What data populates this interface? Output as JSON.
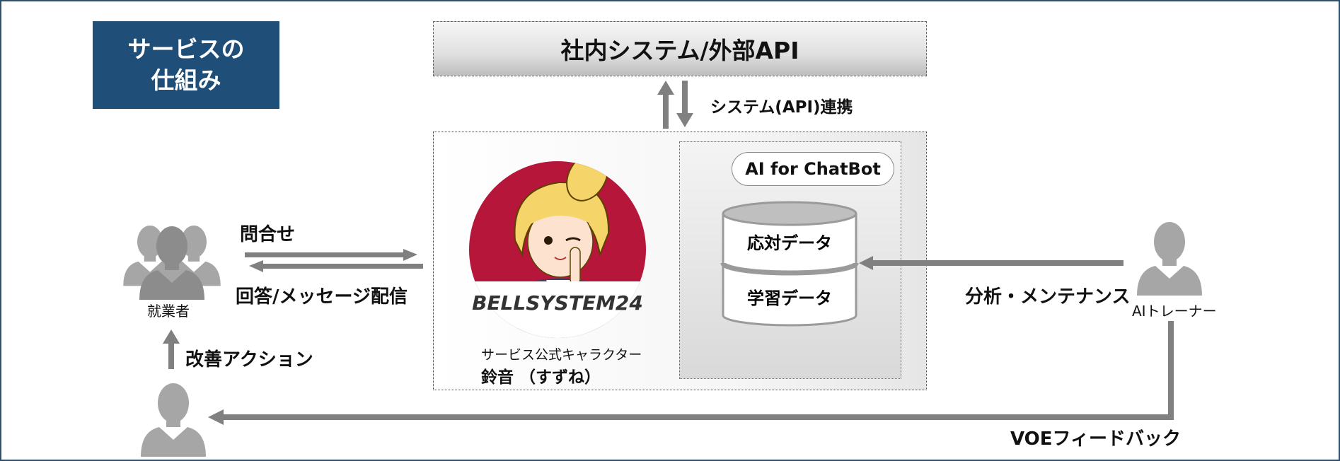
{
  "badge": {
    "line1": "サービスの",
    "line2": "仕組み"
  },
  "system": {
    "title": "社内システム/外部API",
    "link_label": "システム(API)連携"
  },
  "ai": {
    "title": "AI for ChatBot",
    "db_top": "応対データ",
    "db_bottom": "学習データ"
  },
  "character": {
    "brand": "BELLSYSTEM24",
    "caption": "サービス公式キャラクター",
    "name": "鈴音 （すずね）"
  },
  "users": {
    "label": "就業者"
  },
  "trainer": {
    "label": "AIトレーナー"
  },
  "flows": {
    "inquiry": "問合せ",
    "reply": "回答/メッセージ配信",
    "improve": "改善アクション",
    "analysis": "分析・メンテナンス",
    "voe": "VOEフィードバック"
  },
  "colors": {
    "badge": "#1f4e79",
    "arrow": "#808080",
    "character_bg": "#b5163a",
    "person": "#a6a6a6"
  }
}
